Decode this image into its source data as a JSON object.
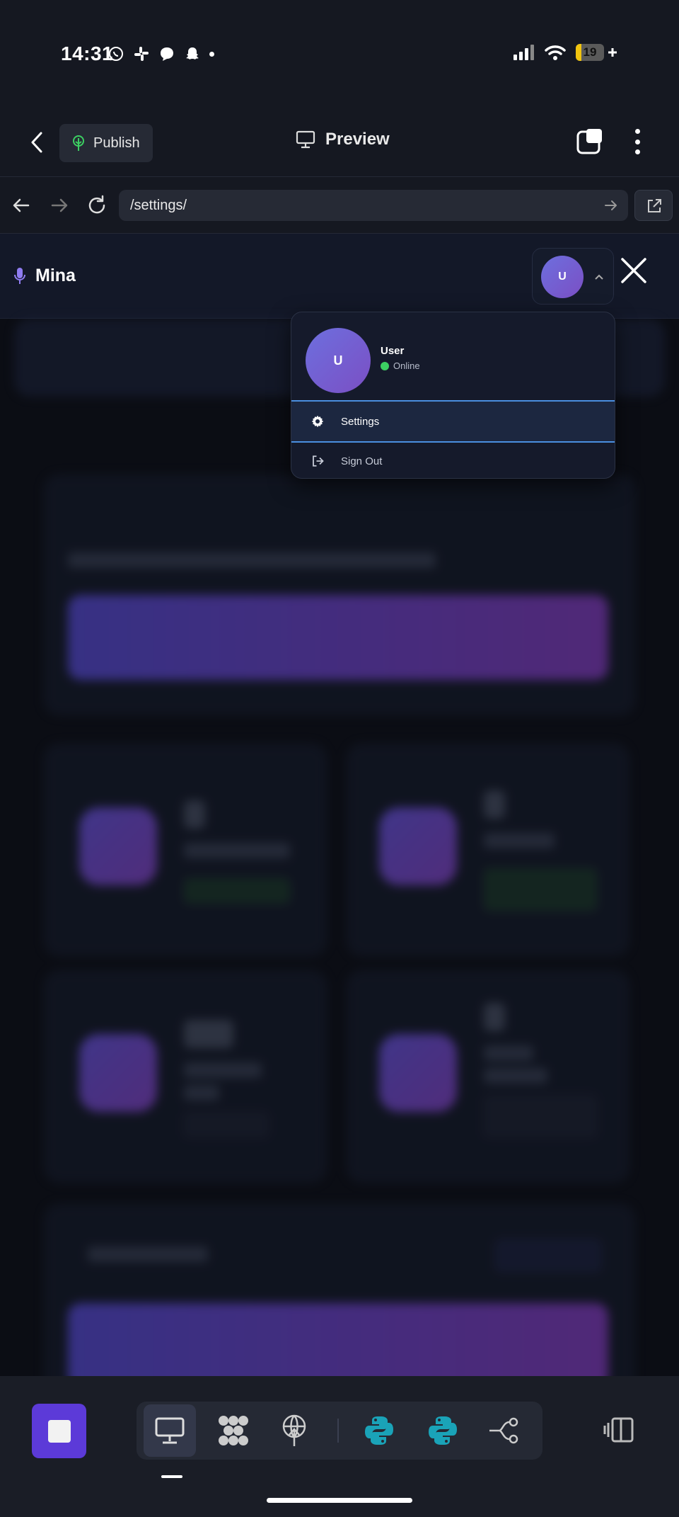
{
  "status_bar": {
    "time": "14:31",
    "battery": "19",
    "battery_level": 0.19,
    "notification_icons": [
      "whatsapp-icon",
      "slack-icon",
      "chat-bubble-icon",
      "snapchat-icon"
    ]
  },
  "app_header": {
    "publish_label": "Publish",
    "preview_label": "Preview"
  },
  "browser": {
    "url": "/settings/"
  },
  "site": {
    "brand_name": "Mina",
    "avatar_initial": "U"
  },
  "user_menu": {
    "avatar_initial": "U",
    "user_name": "User",
    "status": "Online",
    "items": [
      {
        "label": "Settings",
        "icon": "gear-icon"
      },
      {
        "label": "Sign Out",
        "icon": "sign-out-icon"
      }
    ]
  },
  "colors": {
    "accent": "#5c3ad8",
    "online": "#3ccf62",
    "active_outline": "#4a8fe0"
  }
}
